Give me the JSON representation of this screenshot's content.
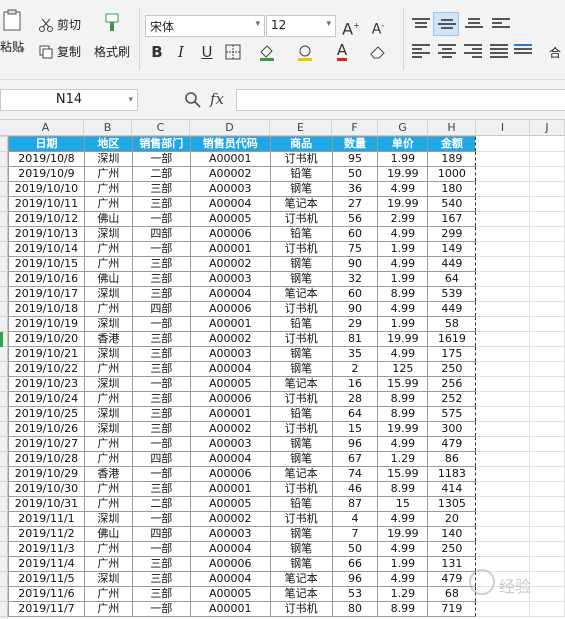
{
  "ribbon": {
    "paste_label": "粘贴",
    "cut_label": "剪切",
    "copy_label": "复制",
    "format_painter_label": "格式刷",
    "font_name": "宋体",
    "font_size": "12",
    "bold": "B",
    "italic": "I",
    "underline": "U",
    "font_color_glyph": "A",
    "merge_label": "合"
  },
  "formula_bar": {
    "name_box": "N14",
    "fx_label": "fx",
    "formula_value": ""
  },
  "columns": [
    "A",
    "B",
    "C",
    "D",
    "E",
    "F",
    "G",
    "H",
    "I",
    "J"
  ],
  "table": {
    "headers": [
      "日期",
      "地区",
      "销售部门",
      "销售员代码",
      "商品",
      "数量",
      "单价",
      "金额"
    ],
    "rows": [
      [
        "2019/10/8",
        "深圳",
        "一部",
        "A00001",
        "订书机",
        "95",
        "1.99",
        "189"
      ],
      [
        "2019/10/9",
        "广州",
        "二部",
        "A00002",
        "铅笔",
        "50",
        "19.99",
        "1000"
      ],
      [
        "2019/10/10",
        "广州",
        "三部",
        "A00003",
        "钢笔",
        "36",
        "4.99",
        "180"
      ],
      [
        "2019/10/11",
        "广州",
        "三部",
        "A00004",
        "笔记本",
        "27",
        "19.99",
        "540"
      ],
      [
        "2019/10/12",
        "佛山",
        "一部",
        "A00005",
        "订书机",
        "56",
        "2.99",
        "167"
      ],
      [
        "2019/10/13",
        "深圳",
        "四部",
        "A00006",
        "铅笔",
        "60",
        "4.99",
        "299"
      ],
      [
        "2019/10/14",
        "广州",
        "一部",
        "A00001",
        "订书机",
        "75",
        "1.99",
        "149"
      ],
      [
        "2019/10/15",
        "广州",
        "三部",
        "A00002",
        "钢笔",
        "90",
        "4.99",
        "449"
      ],
      [
        "2019/10/16",
        "佛山",
        "三部",
        "A00003",
        "钢笔",
        "32",
        "1.99",
        "64"
      ],
      [
        "2019/10/17",
        "深圳",
        "三部",
        "A00004",
        "笔记本",
        "60",
        "8.99",
        "539"
      ],
      [
        "2019/10/18",
        "广州",
        "四部",
        "A00006",
        "订书机",
        "90",
        "4.99",
        "449"
      ],
      [
        "2019/10/19",
        "深圳",
        "一部",
        "A00001",
        "铅笔",
        "29",
        "1.99",
        "58"
      ],
      [
        "2019/10/20",
        "香港",
        "三部",
        "A00002",
        "订书机",
        "81",
        "19.99",
        "1619"
      ],
      [
        "2019/10/21",
        "深圳",
        "三部",
        "A00003",
        "钢笔",
        "35",
        "4.99",
        "175"
      ],
      [
        "2019/10/22",
        "广州",
        "三部",
        "A00004",
        "钢笔",
        "2",
        "125",
        "250"
      ],
      [
        "2019/10/23",
        "深圳",
        "一部",
        "A00005",
        "笔记本",
        "16",
        "15.99",
        "256"
      ],
      [
        "2019/10/24",
        "广州",
        "三部",
        "A00006",
        "订书机",
        "28",
        "8.99",
        "252"
      ],
      [
        "2019/10/25",
        "深圳",
        "三部",
        "A00001",
        "铅笔",
        "64",
        "8.99",
        "575"
      ],
      [
        "2019/10/26",
        "深圳",
        "三部",
        "A00002",
        "订书机",
        "15",
        "19.99",
        "300"
      ],
      [
        "2019/10/27",
        "广州",
        "一部",
        "A00003",
        "钢笔",
        "96",
        "4.99",
        "479"
      ],
      [
        "2019/10/28",
        "广州",
        "四部",
        "A00004",
        "钢笔",
        "67",
        "1.29",
        "86"
      ],
      [
        "2019/10/29",
        "香港",
        "一部",
        "A00006",
        "笔记本",
        "74",
        "15.99",
        "1183"
      ],
      [
        "2019/10/30",
        "广州",
        "三部",
        "A00001",
        "订书机",
        "46",
        "8.99",
        "414"
      ],
      [
        "2019/10/31",
        "广州",
        "二部",
        "A00005",
        "铅笔",
        "87",
        "15",
        "1305"
      ],
      [
        "2019/11/1",
        "深圳",
        "一部",
        "A00002",
        "订书机",
        "4",
        "4.99",
        "20"
      ],
      [
        "2019/11/2",
        "佛山",
        "四部",
        "A00003",
        "钢笔",
        "7",
        "19.99",
        "140"
      ],
      [
        "2019/11/3",
        "广州",
        "一部",
        "A00004",
        "钢笔",
        "50",
        "4.99",
        "250"
      ],
      [
        "2019/11/4",
        "广州",
        "三部",
        "A00006",
        "钢笔",
        "66",
        "1.99",
        "131"
      ],
      [
        "2019/11/5",
        "深圳",
        "三部",
        "A00004",
        "笔记本",
        "96",
        "4.99",
        "479"
      ],
      [
        "2019/11/6",
        "广州",
        "三部",
        "A00005",
        "笔记本",
        "53",
        "1.29",
        "68"
      ],
      [
        "2019/11/7",
        "广州",
        "一部",
        "A00001",
        "订书机",
        "80",
        "8.99",
        "719"
      ]
    ]
  },
  "watermark": {
    "text": "经验"
  }
}
